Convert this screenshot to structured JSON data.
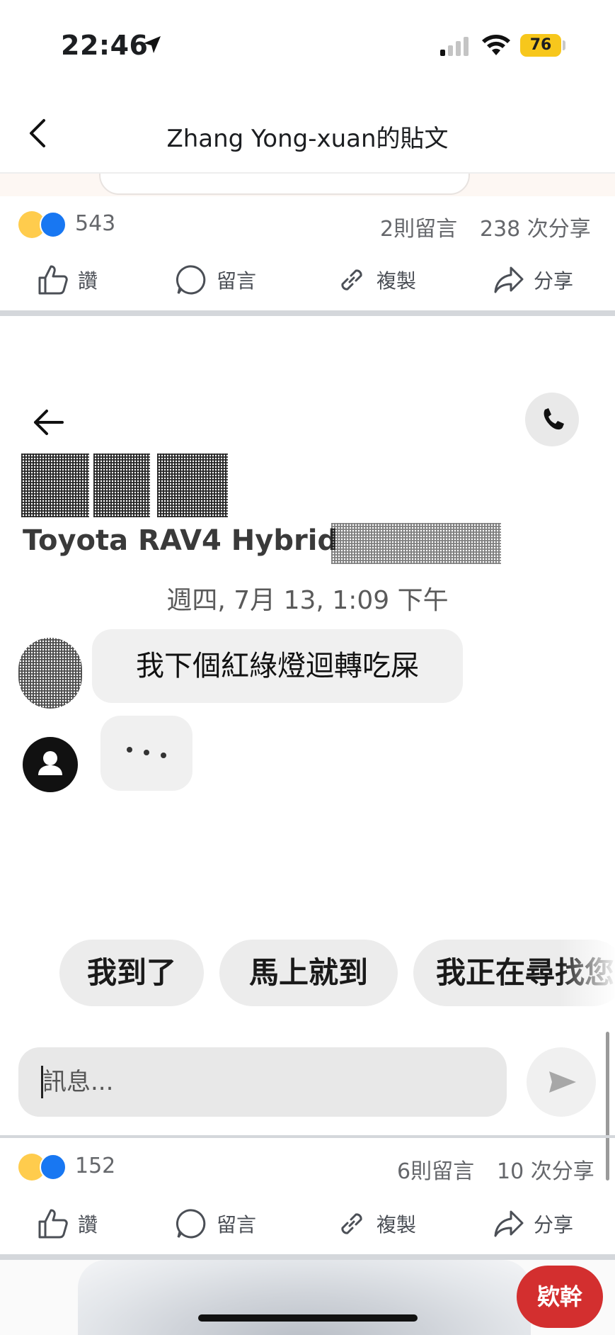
{
  "status_bar": {
    "time": "22:46",
    "battery": "76"
  },
  "header": {
    "title": "Zhang Yong-xuan的貼文"
  },
  "post_top": {
    "reaction_count": "543",
    "comments": "2則留言",
    "shares": "238 次分享",
    "actions": {
      "like": "讚",
      "comment": "留言",
      "copy": "複製",
      "share": "分享"
    }
  },
  "chat": {
    "vehicle": "Toyota RAV4 Hybrid",
    "date": "週四, 7月 13, 1:09 下午",
    "message": "我下個紅綠燈迴轉吃屎",
    "quick_replies": [
      "我到了",
      "馬上就到",
      "我正在尋找您"
    ],
    "input_placeholder": "訊息..."
  },
  "post_bottom": {
    "reaction_count": "152",
    "comments": "6則留言",
    "shares": "10 次分享",
    "actions": {
      "like": "讚",
      "comment": "留言",
      "copy": "複製",
      "share": "分享"
    }
  },
  "badge": {
    "label": "欵幹"
  },
  "colors": {
    "facebook_blue": "#1877f2",
    "battery_yellow": "#f7c71c",
    "badge_red": "#d32f2f"
  },
  "icons": [
    "location-arrow-icon",
    "cellular-signal-icon",
    "wifi-icon",
    "back-chevron-icon",
    "thumbs-up-icon",
    "comment-icon",
    "link-icon",
    "share-icon",
    "back-arrow-icon",
    "phone-icon",
    "user-avatar-icon",
    "send-icon"
  ]
}
